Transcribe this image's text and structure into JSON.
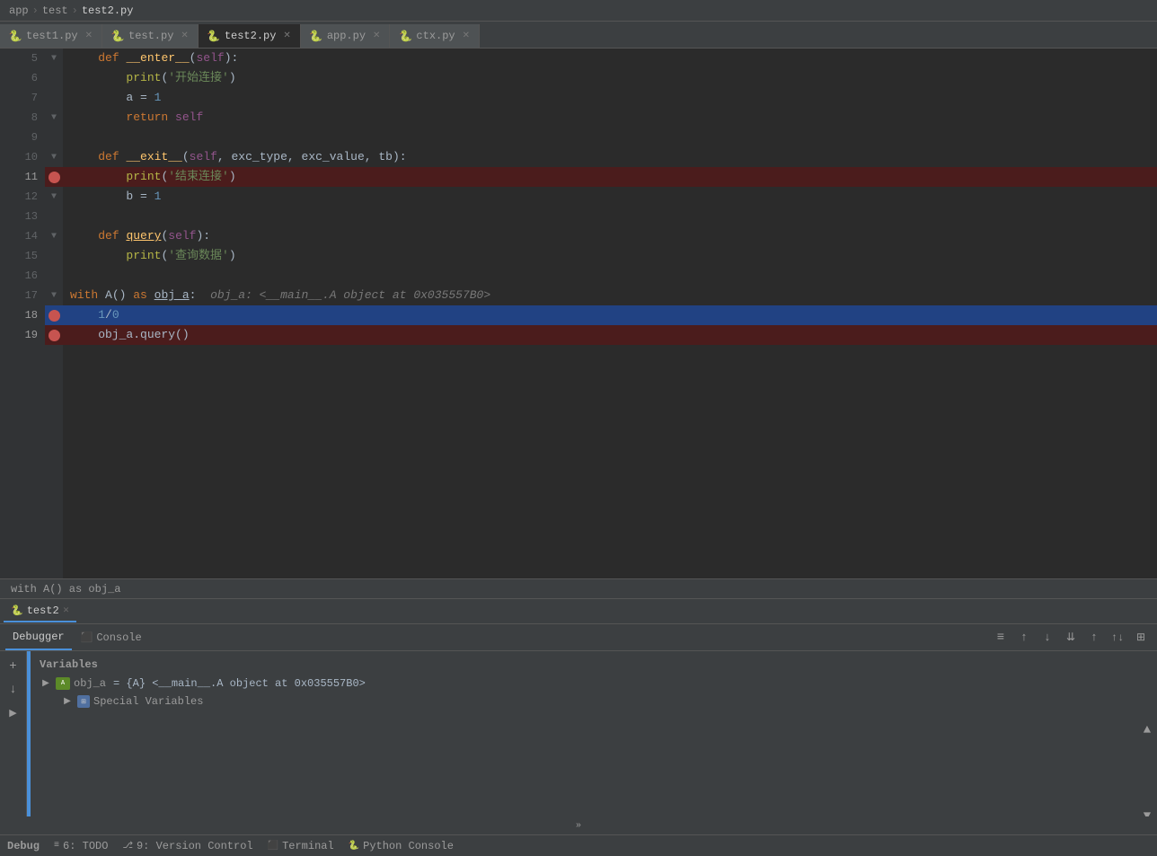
{
  "breadcrumb": {
    "items": [
      "app",
      "test",
      "test2.py"
    ]
  },
  "tabs": [
    {
      "id": "test1",
      "label": "test1.py",
      "active": false,
      "icon": "py"
    },
    {
      "id": "test",
      "label": "test.py",
      "active": false,
      "icon": "py"
    },
    {
      "id": "test2",
      "label": "test2.py",
      "active": true,
      "icon": "py"
    },
    {
      "id": "app",
      "label": "app.py",
      "active": false,
      "icon": "py"
    },
    {
      "id": "ctx",
      "label": "ctx.py",
      "active": false,
      "icon": "py"
    }
  ],
  "code": {
    "lines": [
      {
        "num": 5,
        "content": "    def __enter__(self):",
        "breakpoint": false,
        "selected": false,
        "fold": true
      },
      {
        "num": 6,
        "content": "        print('开始连接')",
        "breakpoint": false,
        "selected": false
      },
      {
        "num": 7,
        "content": "        a = 1",
        "breakpoint": false,
        "selected": false
      },
      {
        "num": 8,
        "content": "        return self",
        "breakpoint": false,
        "selected": false,
        "fold": true
      },
      {
        "num": 9,
        "content": "",
        "breakpoint": false,
        "selected": false
      },
      {
        "num": 10,
        "content": "    def __exit__(self, exc_type, exc_value, tb):",
        "breakpoint": false,
        "selected": false,
        "fold": true
      },
      {
        "num": 11,
        "content": "        print('结束连接')",
        "breakpoint": true,
        "selected": false
      },
      {
        "num": 12,
        "content": "        b = 1",
        "breakpoint": false,
        "selected": false,
        "fold": true
      },
      {
        "num": 13,
        "content": "",
        "breakpoint": false,
        "selected": false
      },
      {
        "num": 14,
        "content": "    def query(self):",
        "breakpoint": false,
        "selected": false,
        "fold": true
      },
      {
        "num": 15,
        "content": "        print('查询数据')",
        "breakpoint": false,
        "selected": false
      },
      {
        "num": 16,
        "content": "",
        "breakpoint": false,
        "selected": false
      },
      {
        "num": 17,
        "content": "with A() as obj_a:",
        "breakpoint": false,
        "selected": false,
        "hint": "obj_a: <__main__.A object at 0x035557B0>",
        "fold": true
      },
      {
        "num": 18,
        "content": "    1/0",
        "breakpoint": true,
        "selected": true
      },
      {
        "num": 19,
        "content": "    obj_a.query()",
        "breakpoint": true,
        "selected": false
      }
    ]
  },
  "tooltip": {
    "text": "with A() as obj_a"
  },
  "debug": {
    "session_tab": "test2",
    "tabs": [
      "Debugger",
      "Console"
    ],
    "active_tab": "Debugger",
    "toolbar_buttons": [
      "≡",
      "↑",
      "↓",
      "↕",
      "↑",
      "↑↓",
      "⊞"
    ],
    "variables_label": "Variables",
    "variables": [
      {
        "name": "obj_a",
        "value": "= {A} <__main__.A object at 0x035557B0>",
        "expanded": true,
        "children": [
          {
            "name": "Special Variables",
            "value": "",
            "icon": "grid"
          }
        ]
      }
    ]
  },
  "statusbar": {
    "debug_label": "Debug",
    "todo_label": "6: TODO",
    "version_label": "9: Version Control",
    "terminal_label": "Terminal",
    "python_console_label": "Python Console"
  }
}
